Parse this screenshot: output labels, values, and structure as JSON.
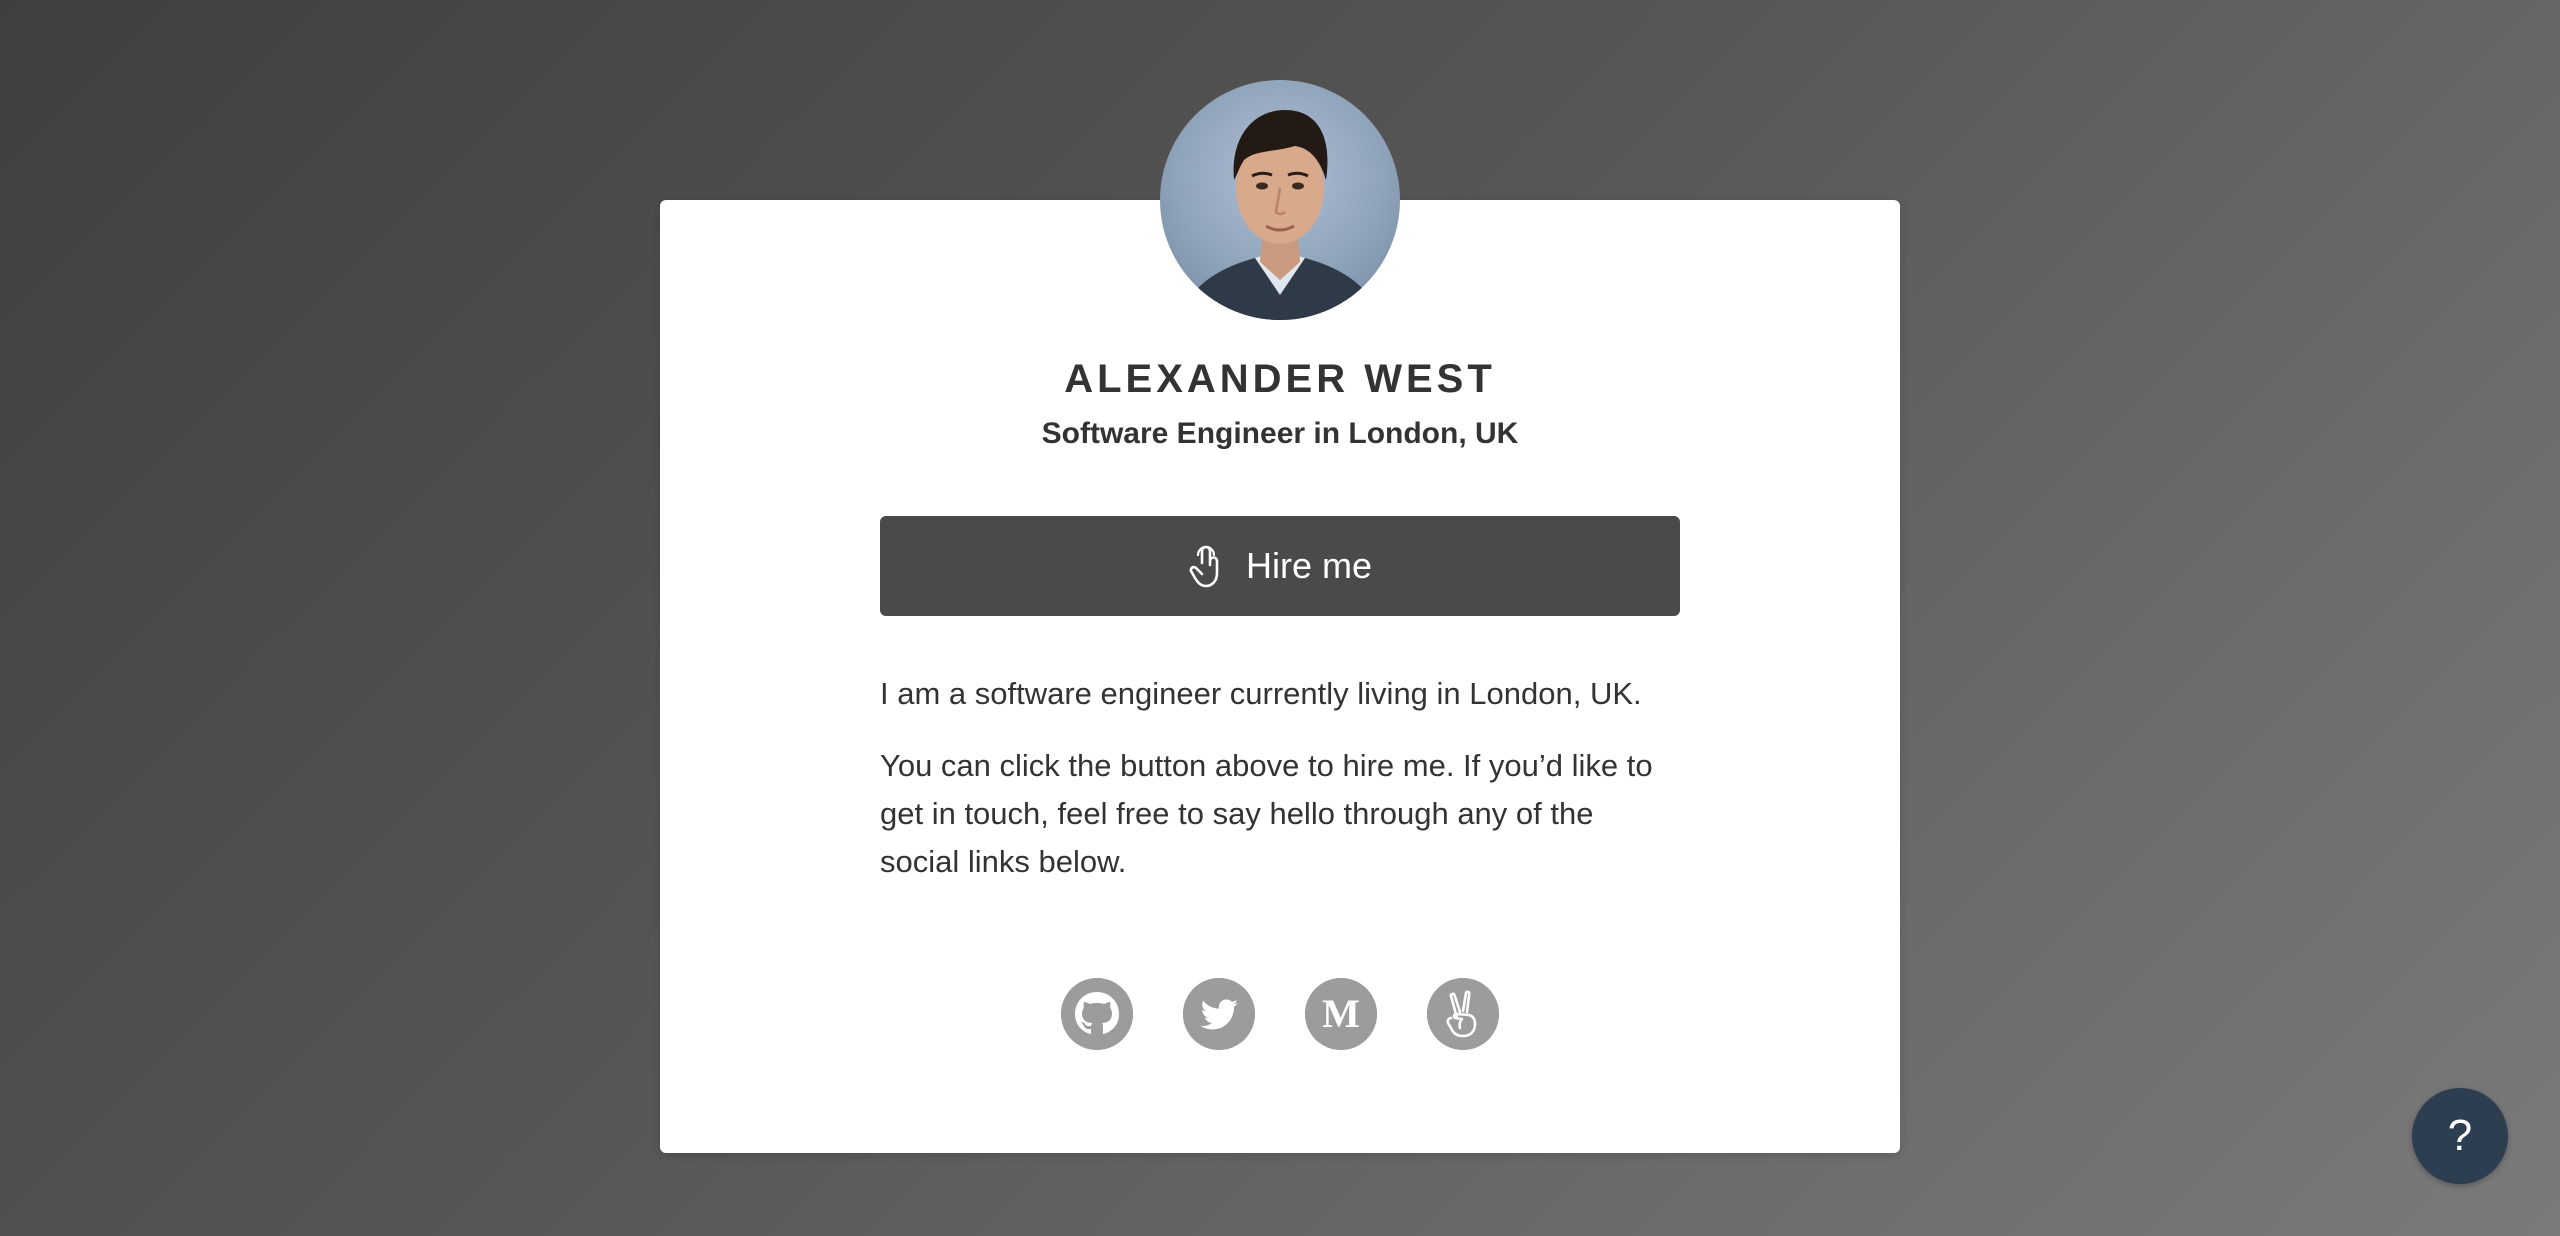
{
  "profile": {
    "name": "ALEXANDER WEST",
    "subtitle": "Software Engineer in London, UK"
  },
  "hire_button": {
    "label": "Hire me",
    "icon": "pointer-hand-icon"
  },
  "bio": {
    "paragraphs": [
      "I am a software engineer currently living in London, UK.",
      "You can click the button above to hire me. If you’d like to get in touch, feel free to say hello through any of the social links below."
    ]
  },
  "social_links": [
    {
      "name": "GitHub",
      "icon": "github-icon"
    },
    {
      "name": "Twitter",
      "icon": "twitter-icon"
    },
    {
      "name": "Medium",
      "icon": "medium-icon"
    },
    {
      "name": "AngelList",
      "icon": "angellist-icon"
    }
  ],
  "help_button": {
    "label": "?"
  },
  "colors": {
    "background": "#555555",
    "card": "#ffffff",
    "button": "#4a4a4a",
    "social_icon": "#9c9c9c",
    "help_button": "#2c3e50",
    "text": "#333333"
  }
}
